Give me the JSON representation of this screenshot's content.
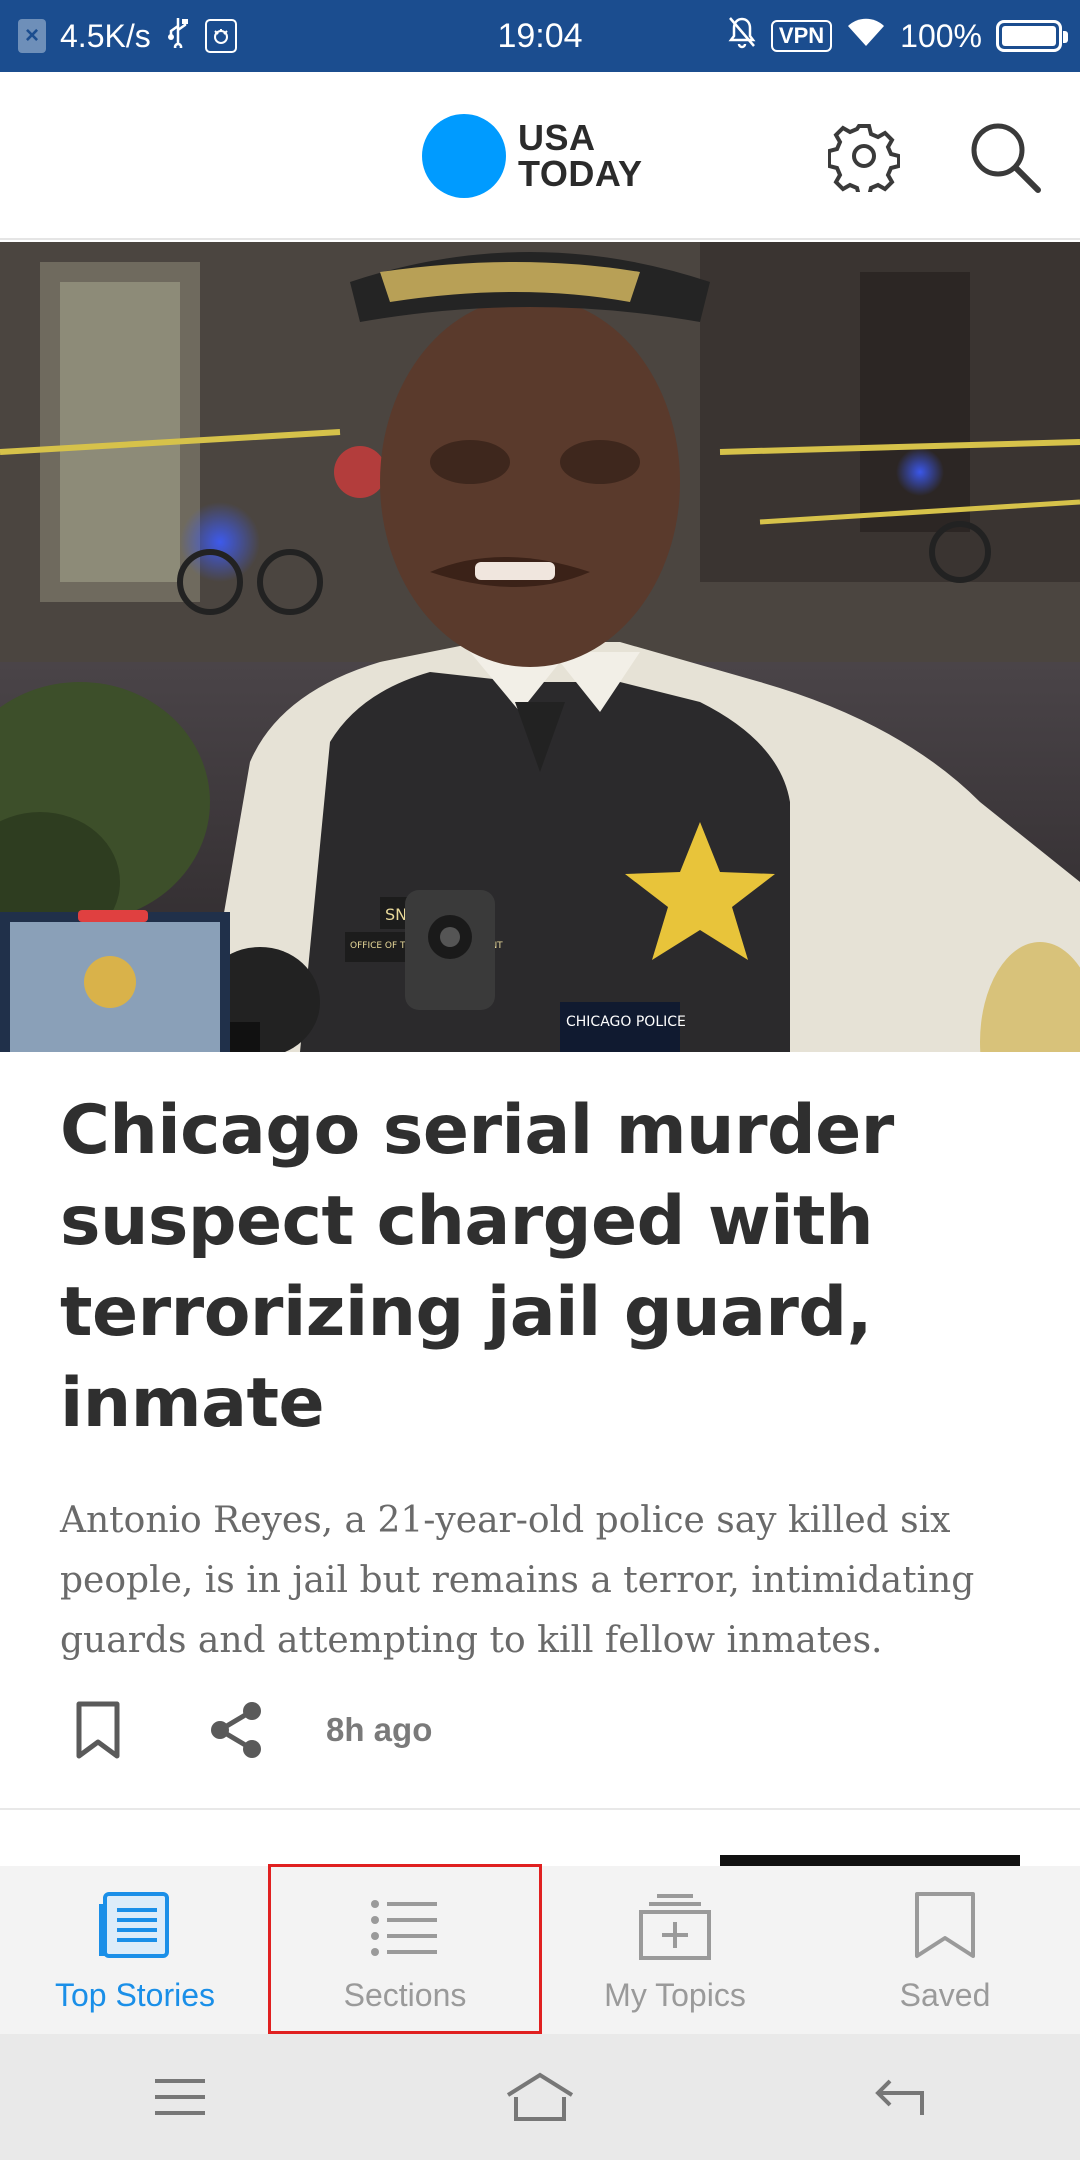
{
  "status_bar": {
    "net_speed": "4.5K/s",
    "time": "19:04",
    "vpn_label": "VPN",
    "battery": "100%",
    "icons": [
      "close-badge-icon",
      "usb-icon",
      "debug-icon",
      "silent-bell-icon",
      "vpn-icon",
      "wifi-icon",
      "battery-icon"
    ]
  },
  "header": {
    "logo_line1": "USA",
    "logo_line2": "TODAY",
    "logo_color": "#009bff",
    "icons": [
      "settings-gear-icon",
      "search-icon"
    ]
  },
  "hero_image": {
    "badge_text_1": "SNELLING",
    "badge_text_2": "OFFICE OF THE SUPERINTENDENT",
    "patch_text": "CHICAGO POLICE"
  },
  "article": {
    "headline": "Chicago serial murder suspect charged with terrorizing jail guard, inmate",
    "summary": "Antonio Reyes, a 21-year-old police say killed six people, is in jail but remains a terror, intimidating guards and attempting to kill fellow inmates.",
    "timestamp": "8h ago",
    "icons": [
      "bookmark-icon",
      "share-icon"
    ]
  },
  "bottom_nav": {
    "tabs": [
      {
        "label": "Top Stories",
        "icon": "newspaper-icon",
        "active": true
      },
      {
        "label": "Sections",
        "icon": "list-icon",
        "active": false
      },
      {
        "label": "My Topics",
        "icon": "add-topic-icon",
        "active": false
      },
      {
        "label": "Saved",
        "icon": "bookmark-icon",
        "active": false
      }
    ],
    "active_color": "#1a8fe8",
    "inactive_color": "#9a9a9a",
    "highlight_color": "#e02020"
  },
  "system_nav": {
    "icons": [
      "menu-icon",
      "home-icon",
      "back-icon"
    ]
  }
}
